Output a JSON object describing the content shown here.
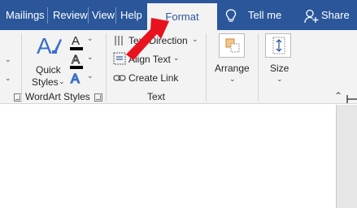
{
  "tabs": {
    "mailings": "Mailings",
    "review": "Review",
    "view": "View",
    "help": "Help",
    "format": "Format",
    "tell_me": "Tell me",
    "share": "Share"
  },
  "wordart": {
    "quick_styles_line1": "Quick",
    "quick_styles_line2": "Styles",
    "group_label": "WordArt Styles"
  },
  "text_group": {
    "text_direction": "Text Direction",
    "align_text": "Align Text",
    "create_link": "Create Link",
    "group_label": "Text"
  },
  "arrange": {
    "label": "Arrange"
  },
  "size": {
    "label": "Size"
  },
  "colors": {
    "tab_bar": "#2b579a",
    "ribbon": "#f3f3f3",
    "annotation_arrow": "#e8121e",
    "wordart_blue": "#3b6ec9"
  }
}
